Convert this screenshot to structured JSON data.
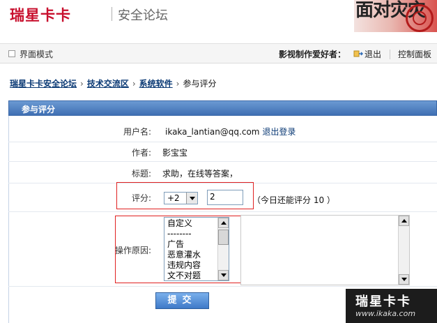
{
  "header": {
    "logo": "瑞星卡卡",
    "forum_name": "安全论坛",
    "banner_text": "面对灾灾"
  },
  "topbar": {
    "mode_label": "界面模式",
    "user_label": "影视制作爱好者：",
    "logout_label": "退出",
    "control_panel_label": "控制面板"
  },
  "breadcrumb": {
    "items": [
      "瑞星卡卡安全论坛",
      "技术交流区",
      "系统软件"
    ],
    "current": "参与评分",
    "separator": "›"
  },
  "panel": {
    "title": "参与评分"
  },
  "form": {
    "username_label": "用户名:",
    "username_value": "ikaka_lantian@qq.com",
    "logout_link": "退出登录",
    "author_label": "作者:",
    "author_value": "影宝宝",
    "subject_label": "标题:",
    "subject_value": "求助，在线等答案，",
    "score_label": "评分:",
    "score_select_value": "+2",
    "score_input_value": "2",
    "score_remaining": "（今日还能评分 10 ）",
    "reason_label": "操作原因:",
    "reason_options": [
      "自定义",
      "--------",
      "广告",
      "恶意灌水",
      "违规内容",
      "文不对题"
    ],
    "submit_label": "提交"
  },
  "watermark": {
    "title": "瑞星卡卡",
    "url": "www.ikaka.com"
  },
  "colors": {
    "brand_red": "#c8102e",
    "panel_blue": "#3f6fb3",
    "link_blue": "#0b3a75",
    "highlight_red": "#e02020"
  }
}
